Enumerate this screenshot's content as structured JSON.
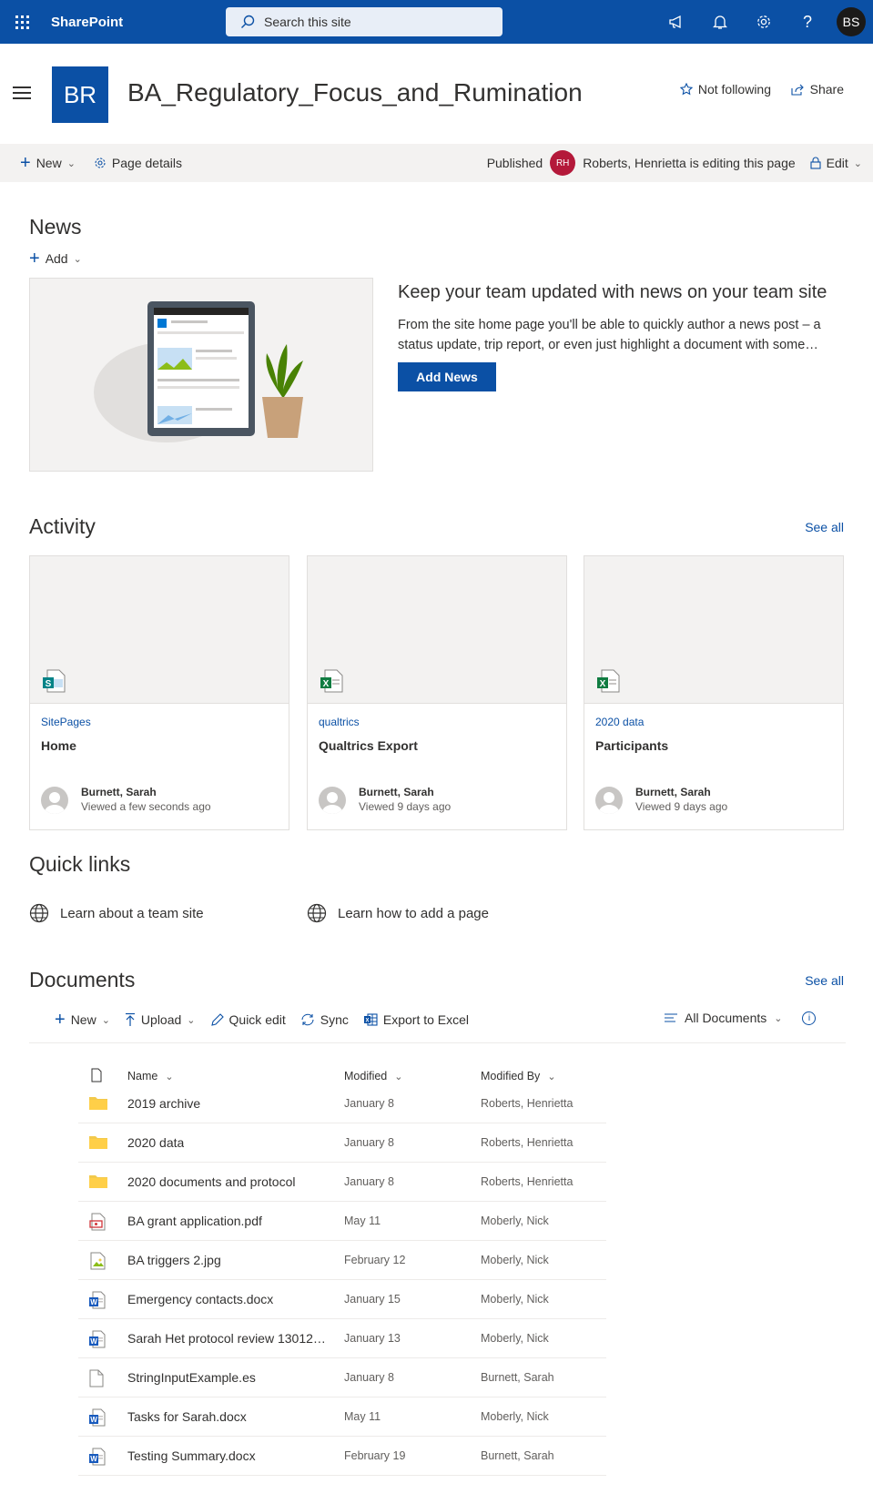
{
  "suite": {
    "brand": "SharePoint",
    "search_placeholder": "Search this site",
    "me_initials": "BS"
  },
  "site": {
    "logo_text": "BR",
    "title": "BA_Regulatory_Focus_and_Rumination",
    "follow_label": "Not following",
    "share_label": "Share"
  },
  "command_bar": {
    "new_label": "New",
    "page_details_label": "Page details",
    "status": "Published",
    "editor_initials": "RH",
    "editor_text": "Roberts, Henrietta is editing this page",
    "edit_label": "Edit"
  },
  "news": {
    "heading": "News",
    "add_label": "Add",
    "title": "Keep your team updated with news on your team site",
    "description": "From the site home page you'll be able to quickly author a news post – a status update, trip report, or even just highlight a document with some…",
    "button": "Add News"
  },
  "activity": {
    "heading": "Activity",
    "see_all": "See all",
    "cards": [
      {
        "library": "SitePages",
        "title": "Home",
        "person": "Burnett, Sarah",
        "viewed": "Viewed a few seconds ago",
        "file_icon": "sharepoint-page-icon"
      },
      {
        "library": "qualtrics",
        "title": "Qualtrics Export",
        "person": "Burnett, Sarah",
        "viewed": "Viewed 9 days ago",
        "file_icon": "excel-icon"
      },
      {
        "library": "2020 data",
        "title": "Participants",
        "person": "Burnett, Sarah",
        "viewed": "Viewed 9 days ago",
        "file_icon": "excel-icon"
      }
    ]
  },
  "quick_links": {
    "heading": "Quick links",
    "items": [
      "Learn about a team site",
      "Learn how to add a page"
    ]
  },
  "documents": {
    "heading": "Documents",
    "see_all": "See all",
    "commands": {
      "new": "New",
      "upload": "Upload",
      "quick_edit": "Quick edit",
      "sync": "Sync",
      "export": "Export to Excel"
    },
    "view": "All Documents",
    "columns": {
      "name": "Name",
      "modified": "Modified",
      "modified_by": "Modified By"
    },
    "rows": [
      {
        "type": "folder",
        "name": "2019 archive",
        "modified": "January 8",
        "modified_by": "Roberts, Henrietta"
      },
      {
        "type": "folder",
        "name": "2020 data",
        "modified": "January 8",
        "modified_by": "Roberts, Henrietta"
      },
      {
        "type": "folder",
        "name": "2020 documents and protocol",
        "modified": "January 8",
        "modified_by": "Roberts, Henrietta"
      },
      {
        "type": "pdf",
        "name": "BA grant application.pdf",
        "modified": "May 11",
        "modified_by": "Moberly, Nick"
      },
      {
        "type": "image",
        "name": "BA triggers 2.jpg",
        "modified": "February 12",
        "modified_by": "Moberly, Nick"
      },
      {
        "type": "word",
        "name": "Emergency contacts.docx",
        "modified": "January 15",
        "modified_by": "Moberly, Nick"
      },
      {
        "type": "word",
        "name": "Sarah Het protocol review 130120...",
        "modified": "January 13",
        "modified_by": "Moberly, Nick"
      },
      {
        "type": "generic",
        "name": "StringInputExample.es",
        "modified": "January 8",
        "modified_by": "Burnett, Sarah"
      },
      {
        "type": "word",
        "name": "Tasks for Sarah.docx",
        "modified": "May 11",
        "modified_by": "Moberly, Nick"
      },
      {
        "type": "word",
        "name": "Testing Summary.docx",
        "modified": "February 19",
        "modified_by": "Burnett, Sarah"
      }
    ]
  }
}
